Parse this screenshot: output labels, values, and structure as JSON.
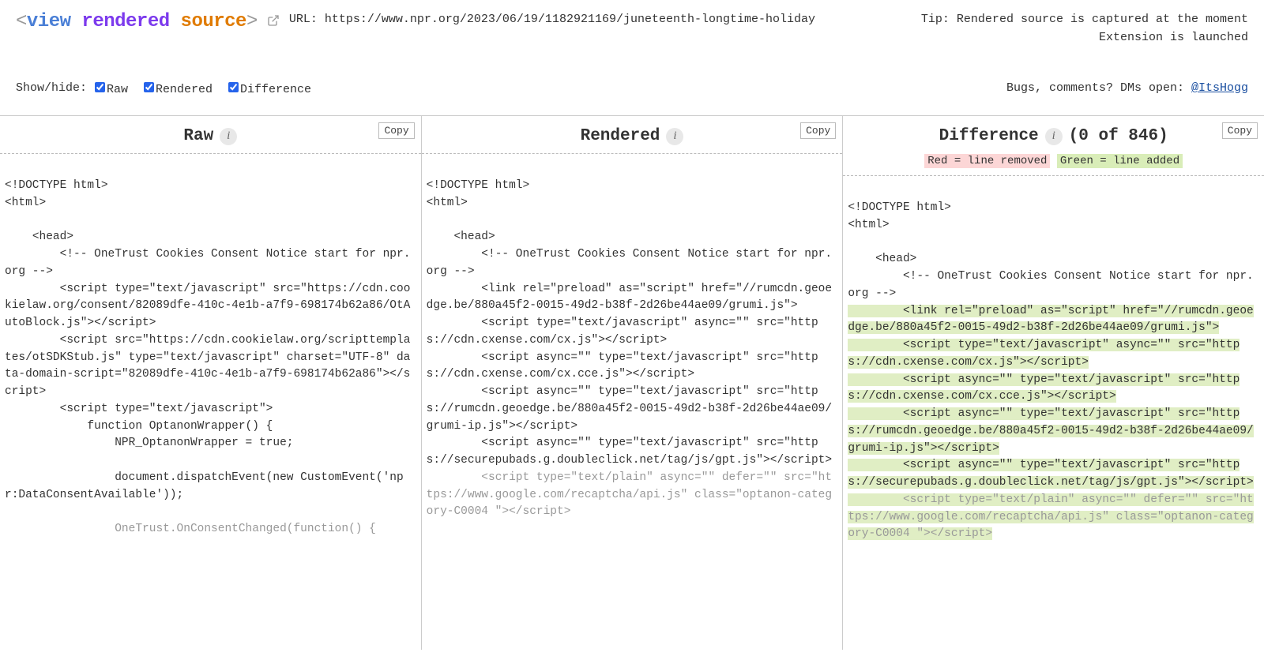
{
  "header": {
    "logo_lt": "<",
    "logo_view": "view",
    "logo_rendered": "rendered",
    "logo_source": "source",
    "logo_gt": ">",
    "url_label": "URL: ",
    "url_value": "https://www.npr.org/2023/06/19/1182921169/juneteenth-longtime-holiday",
    "tip_text": "Tip: Rendered source is captured at the moment Extension is launched"
  },
  "toggles": {
    "label": "Show/hide: ",
    "raw": "Raw",
    "rendered": "Rendered",
    "difference": "Difference"
  },
  "bugs": {
    "text": "Bugs, comments? DMs open: ",
    "handle": "@ItsHogg"
  },
  "columns": {
    "raw": {
      "title": "Raw",
      "copy": "Copy"
    },
    "rendered": {
      "title": "Rendered",
      "copy": "Copy"
    },
    "diff": {
      "title": "Difference",
      "count": "(0 of 846)",
      "copy": "Copy",
      "legend_removed": "Red = line removed",
      "legend_added": "Green = line added"
    }
  },
  "code": {
    "raw_body": "<!DOCTYPE html>\n<html>\n\n    <head>\n        <!-- OneTrust Cookies Consent Notice start for npr.org -->\n        <script type=\"text/javascript\" src=\"https://cdn.cookielaw.org/consent/82089dfe-410c-4e1b-a7f9-698174b62a86/OtAutoBlock.js\"></script>\n        <script src=\"https://cdn.cookielaw.org/scripttemplates/otSDKStub.js\" type=\"text/javascript\" charset=\"UTF-8\" data-domain-script=\"82089dfe-410c-4e1b-a7f9-698174b62a86\"></script>\n        <script type=\"text/javascript\">\n            function OptanonWrapper() {\n                NPR_OptanonWrapper = true;\n\n                document.dispatchEvent(new CustomEvent('npr:DataConsentAvailable'));",
    "raw_body_faded": "\n\n                OneTrust.OnConsentChanged(function() {",
    "rendered_body": "<!DOCTYPE html>\n<html>\n\n    <head>\n        <!-- OneTrust Cookies Consent Notice start for npr.org -->\n        <link rel=\"preload\" as=\"script\" href=\"//rumcdn.geoedge.be/880a45f2-0015-49d2-b38f-2d26be44ae09/grumi.js\">\n        <script type=\"text/javascript\" async=\"\" src=\"https://cdn.cxense.com/cx.js\"></script>\n        <script async=\"\" type=\"text/javascript\" src=\"https://cdn.cxense.com/cx.cce.js\"></script>\n        <script async=\"\" type=\"text/javascript\" src=\"https://rumcdn.geoedge.be/880a45f2-0015-49d2-b38f-2d26be44ae09/grumi-ip.js\"></script>\n        <script async=\"\" type=\"text/javascript\" src=\"https://securepubads.g.doubleclick.net/tag/js/gpt.js\"></script>",
    "rendered_body_faded": "\n        <script type=\"text/plain\" async=\"\" defer=\"\" src=\"https://www.google.com/recaptcha/api.js\" class=\"optanon-category-C0004 \"></script>",
    "diff_plain_1": "<!DOCTYPE html>\n<html>\n\n    <head>\n        <!-- OneTrust Cookies Consent Notice start for npr.org -->\n",
    "diff_green_1": "        <link rel=\"preload\" as=\"script\" href=\"//rumcdn.geoedge.be/880a45f2-0015-49d2-b38f-2d26be44ae09/grumi.js\">",
    "diff_green_2": "        <script type=\"text/javascript\" async=\"\" src=\"https://cdn.cxense.com/cx.js\"></script>",
    "diff_green_3": "        <script async=\"\" type=\"text/javascript\" src=\"https://cdn.cxense.com/cx.cce.js\"></script>",
    "diff_green_4": "        <script async=\"\" type=\"text/javascript\" src=\"https://rumcdn.geoedge.be/880a45f2-0015-49d2-b38f-2d26be44ae09/grumi-ip.js\"></script>",
    "diff_green_5": "        <script async=\"\" type=\"text/javascript\" src=\"https://securepubads.g.doubleclick.net/tag/js/gpt.js\"></script>",
    "diff_green_6_faded": "        <script type=\"text/plain\" async=\"\" defer=\"\" src=\"https://www.google.com/recaptcha/api.js\" class=\"optanon-category-C0004 \"></script>"
  }
}
